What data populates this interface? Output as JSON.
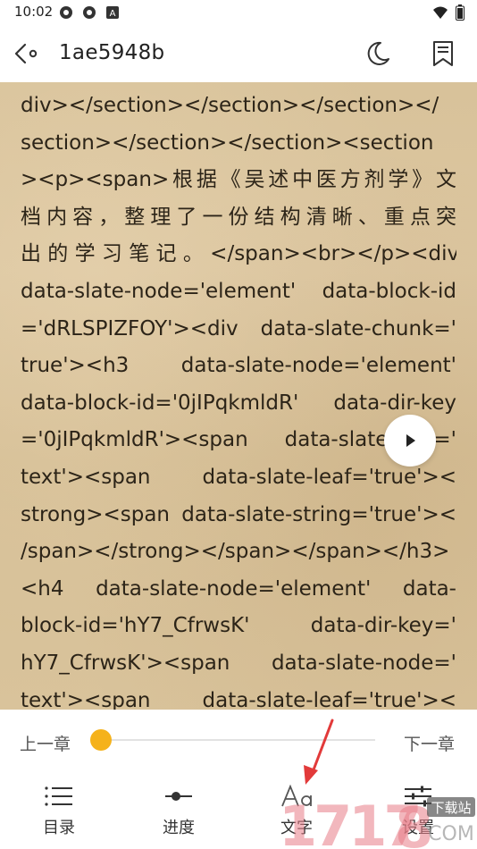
{
  "status_bar": {
    "time": "10:02"
  },
  "header": {
    "title": "1ae5948b"
  },
  "reader": {
    "lines": [
      "div></section></section></section></",
      "section></section></section><section",
      "><p><span>根据《吴述中医方剂学》文",
      "档内容，整理了一份结构清晰、重点突",
      "出 的 学 习 笔 记 。 </span><br></p><div",
      "data-slate-node='element' data-block-id",
      "='dRLSPIZFOY'><div data-slate-chunk='",
      "true'><h3      data-slate-node='element'",
      "data-block-id='0jIPqkmldR' data-dir-key",
      "='0jIPqkmldR'><span data-slate-leaf='",
      "text'><span       data-slate-leaf='true'><",
      "strong><span data-slate-string='true'><",
      "/span></strong></span></span></h3>",
      "<h4   data-slate-node='element'   data-",
      "block-id='hY7_CfrwsK'    data-dir-key='",
      "hY7_CfrwsK'><span data-slate-node='",
      "text'><span      data-slate-leaf='true'><"
    ]
  },
  "panel": {
    "prev_chapter": "上一章",
    "next_chapter": "下一章",
    "progress": 0.0,
    "tabs": [
      {
        "label": "目录",
        "icon": "toc-list-icon"
      },
      {
        "label": "进度",
        "icon": "progress-icon"
      },
      {
        "label": "文字",
        "icon": "font-size-icon"
      },
      {
        "label": "设置",
        "icon": "settings-sliders-icon"
      }
    ]
  },
  "watermark": {
    "text": "1717",
    "site_text": "下载站",
    "domain_text": "COM"
  },
  "colors": {
    "accent": "#f5b21b",
    "paper": "#d8c29a",
    "arrow": "#e23a3a"
  }
}
